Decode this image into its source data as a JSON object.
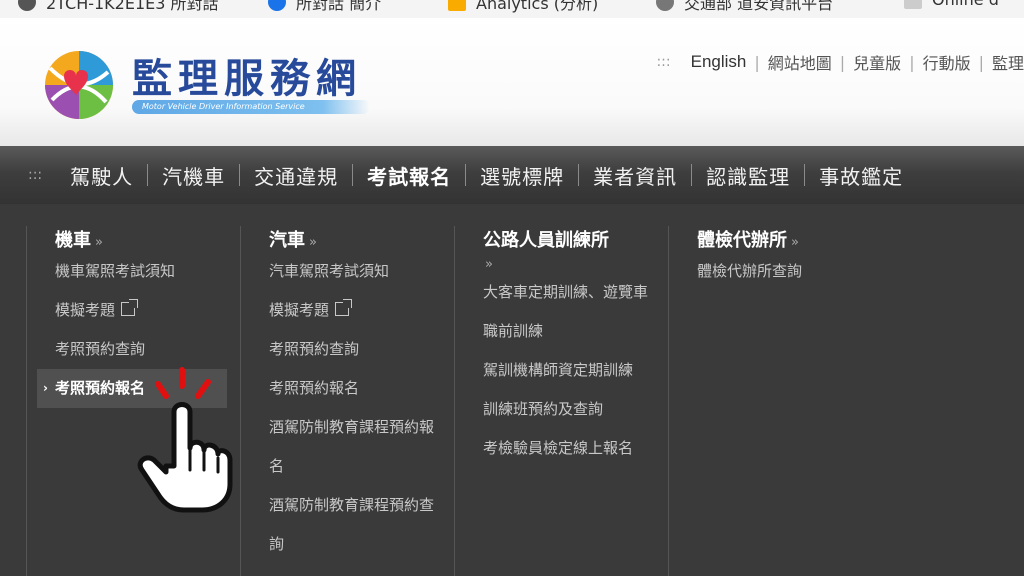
{
  "bookmarks": [
    {
      "label": "2TCH-1K2E1E3 所對話",
      "icon_color": "#555555"
    },
    {
      "label": "所對話 簡介",
      "icon_color": "#1a73e8"
    },
    {
      "label": "Analytics (分析)",
      "icon_color": "#f9ab00"
    },
    {
      "label": "交通部 道安資訊平台",
      "icon_color": "#777777"
    },
    {
      "label": "Online d",
      "icon_color": "#cccccc"
    }
  ],
  "site": {
    "title": "監理服務網",
    "subtitle": "Motor Vehicle Driver Information Service"
  },
  "toplinks": {
    "dots": ":::",
    "items": [
      "English",
      "網站地圖",
      "兒童版",
      "行動版",
      "監理"
    ]
  },
  "nav": {
    "dots": ":::",
    "items": [
      "駕駛人",
      "汽機車",
      "交通違規",
      "考試報名",
      "選號標牌",
      "業者資訊",
      "認識監理",
      "事故鑑定"
    ],
    "active_index": 3
  },
  "menu": {
    "chevron": "»",
    "columns": [
      {
        "heading": "機車",
        "items": [
          "機車駕照考試須知",
          "模擬考題",
          "考照預約查詢",
          "考照預約報名"
        ]
      },
      {
        "heading": "汽車",
        "items": [
          "汽車駕照考試須知",
          "模擬考題",
          "考照預約查詢",
          "考照預約報名",
          "酒駕防制教育課程預約報名",
          "酒駕防制教育課程預約查詢"
        ]
      },
      {
        "heading": "公路人員訓練所",
        "items": [
          "大客車定期訓練、遊覽車職前訓練",
          "駕訓機構師資定期訓練",
          "訓練班預約及查詢",
          "考檢驗員檢定線上報名"
        ]
      },
      {
        "heading": "體檢代辦所",
        "items": [
          "體檢代辦所查詢"
        ]
      }
    ],
    "highlighted_item": "考照預約報名"
  },
  "colors": {
    "nav_bg": "#3e3e3e",
    "menu_bg": "#3a3a3a",
    "highlight_bg": "#505050",
    "brand_blue": "#274a9a",
    "click_marks": "#e01010"
  },
  "annotation_icon": "pointing-hand-click-icon"
}
